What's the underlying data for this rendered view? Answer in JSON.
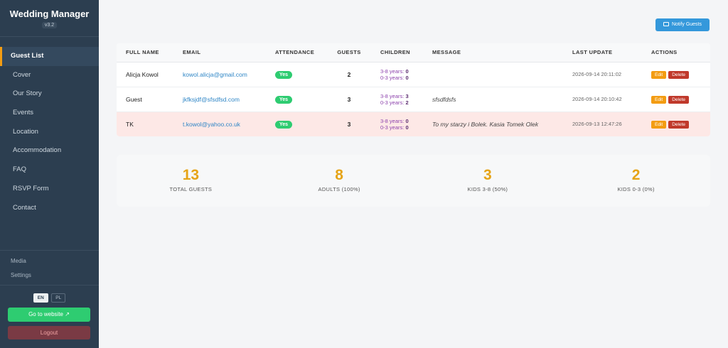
{
  "app": {
    "title": "Wedding Manager",
    "version": "v3.2"
  },
  "sidebar": {
    "items": [
      {
        "label": "Guest List",
        "active": true
      },
      {
        "label": "Cover"
      },
      {
        "label": "Our Story"
      },
      {
        "label": "Events"
      },
      {
        "label": "Location"
      },
      {
        "label": "Accommodation"
      },
      {
        "label": "FAQ"
      },
      {
        "label": "RSVP Form"
      },
      {
        "label": "Contact"
      }
    ],
    "secondary": [
      {
        "label": "Media"
      },
      {
        "label": "Settings"
      }
    ],
    "languages": [
      {
        "code": "EN",
        "active": true
      },
      {
        "code": "PL"
      }
    ],
    "website_label": "Go to website ↗",
    "logout_label": "Logout"
  },
  "toolbar": {
    "notify_label": "Notify Guests"
  },
  "table": {
    "headers": [
      "FULL NAME",
      "EMAIL",
      "ATTENDANCE",
      "GUESTS",
      "CHILDREN",
      "MESSAGE",
      "LAST UPDATE",
      "ACTIONS"
    ],
    "children_labels": {
      "age_3_8": "3-8 years:",
      "age_0_3": "0-3 years:"
    },
    "edit_label": "Edit",
    "delete_label": "Delete",
    "rows": [
      {
        "name": "Alicja Kowol",
        "email": "kowol.alicja@gmail.com",
        "attendance": "Yes",
        "guests": "2",
        "kids_3_8": "0",
        "kids_0_3": "0",
        "message": "",
        "updated": "2026-09-14 20:11:02"
      },
      {
        "name": "Guest",
        "email": "jkfksjdf@sfsdfsd.com",
        "attendance": "Yes",
        "guests": "3",
        "kids_3_8": "3",
        "kids_0_3": "2",
        "message": "sfsdfdsfs",
        "updated": "2026-09-14 20:10:42"
      },
      {
        "name": "TK",
        "email": "t.kowol@yahoo.co.uk",
        "attendance": "Yes",
        "guests": "3",
        "kids_3_8": "0",
        "kids_0_3": "0",
        "message": "To my starzy i Bolek. Kasia Tomek Olek",
        "updated": "2026-09-13 12:47:26",
        "highlight": true
      }
    ]
  },
  "stats": [
    {
      "value": "13",
      "label": "TOTAL GUESTS"
    },
    {
      "value": "8",
      "label": "ADULTS (100%)"
    },
    {
      "value": "3",
      "label": "KIDS 3-8 (50%)"
    },
    {
      "value": "2",
      "label": "KIDS 0-3 (0%)"
    }
  ],
  "colors": {
    "sidebar": "#2c3e50",
    "accent": "#f39c12",
    "stat": "#e6a417",
    "primary": "#3498db",
    "success": "#2ecc71",
    "danger": "#c0392b"
  }
}
